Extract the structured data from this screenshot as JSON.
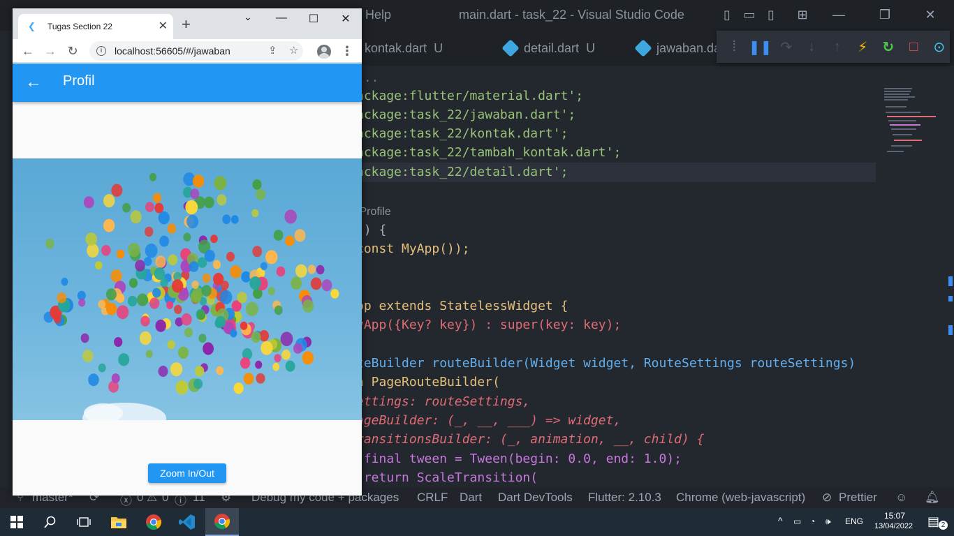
{
  "vscode": {
    "title": "main.dart - task_22 - Visual Studio Code",
    "menu_help": "Help",
    "tabs": [
      {
        "name": "kontak.dart",
        "badge": "U"
      },
      {
        "name": "detail.dart",
        "badge": "U"
      },
      {
        "name": "jawaban.da",
        "badge": ""
      }
    ],
    "breadcrumb": "...",
    "code_lines": [
      "ackage:flutter/material.dart';",
      "ackage:task_22/jawaban.dart';",
      "ackage:task_22/kontak.dart';",
      "ackage:task_22/tambah_kontak.dart';",
      "ackage:task_22/detail.dart';",
      "",
      " Profile",
      "() {",
      "const MyApp());",
      "",
      "",
      "pp extends StatelessWidget {",
      "yApp({Key? key}) : super(key: key);",
      "",
      "teBuilder routeBuilder(Widget widget, RouteSettings routeSettings)",
      "n PageRouteBuilder(",
      "ettings: routeSettings,",
      "ageBuilder: (_, __, ___) => widget,",
      "ransitionsBuilder: (_, animation, __, child) {",
      " final tween = Tween(begin: 0.0, end: 1.0);",
      " return ScaleTransition("
    ],
    "statusbar": {
      "branch": "master*",
      "errors": "0",
      "warnings": "0",
      "infos": "11",
      "debug": "Debug my code + packages",
      "eol": "CRLF",
      "language": "Dart",
      "devtools": "Dart DevTools",
      "flutter": "Flutter: 2.10.3",
      "device": "Chrome (web-javascript)",
      "prettier": "Prettier"
    }
  },
  "browser": {
    "tab_title": "Tugas Section 22",
    "url": "localhost:56605/#/jawaban"
  },
  "app": {
    "title": "Profil",
    "zoom_button": "Zoom In/Out"
  },
  "taskbar": {
    "language": "ENG",
    "time": "15:07",
    "date": "13/04/2022",
    "notifications": "2"
  },
  "colors": {
    "app_bar": "#2196f3",
    "vscode_bg": "#23272e",
    "taskbar": "#202b38"
  }
}
